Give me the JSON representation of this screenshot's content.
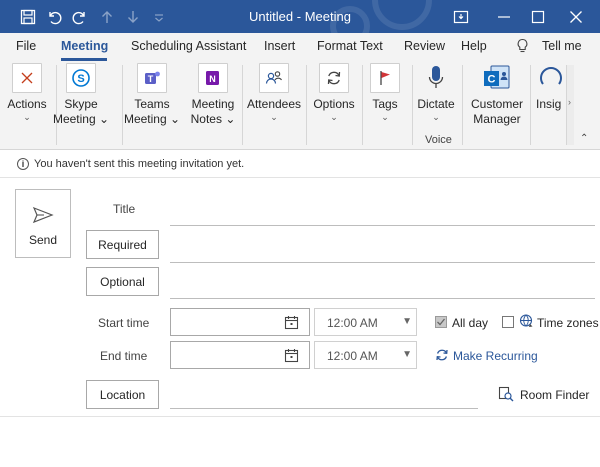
{
  "window": {
    "title": "Untitled",
    "separator": "-",
    "app": "Meeting"
  },
  "tabs": [
    "File",
    "Meeting",
    "Scheduling Assistant",
    "Insert",
    "Format Text",
    "Review",
    "Help",
    "Tell me"
  ],
  "ribbon": {
    "actions": "Actions",
    "skype_1": "Skype",
    "skype_2": "Meeting",
    "teams_1": "Teams",
    "teams_2": "Meeting",
    "notes_1": "Meeting",
    "notes_2": "Notes",
    "attendees": "Attendees",
    "options": "Options",
    "tags": "Tags",
    "dictate": "Dictate",
    "voice_group": "Voice",
    "customer_1": "Customer",
    "customer_2": "Manager",
    "insights": "Insig"
  },
  "infobar": {
    "icon": "i",
    "text": "You haven't sent this meeting invitation yet."
  },
  "form": {
    "send": "Send",
    "title_label": "Title",
    "required": "Required",
    "optional": "Optional",
    "start_time_label": "Start time",
    "end_time_label": "End time",
    "start_time": "12:00 AM",
    "end_time": "12:00 AM",
    "all_day": "All day",
    "all_day_checked": true,
    "time_zones": "Time zones",
    "time_zones_checked": false,
    "make_recurring": "Make Recurring",
    "location": "Location",
    "room_finder": "Room Finder"
  },
  "colors": {
    "titlebar": "#2b579a",
    "ribbon": "#f3f3f3",
    "accent": "#2b579a",
    "teams": "#5b5fc7",
    "onenote": "#7719aa",
    "skype": "#0078d4",
    "close_x": "#c43e1c"
  }
}
